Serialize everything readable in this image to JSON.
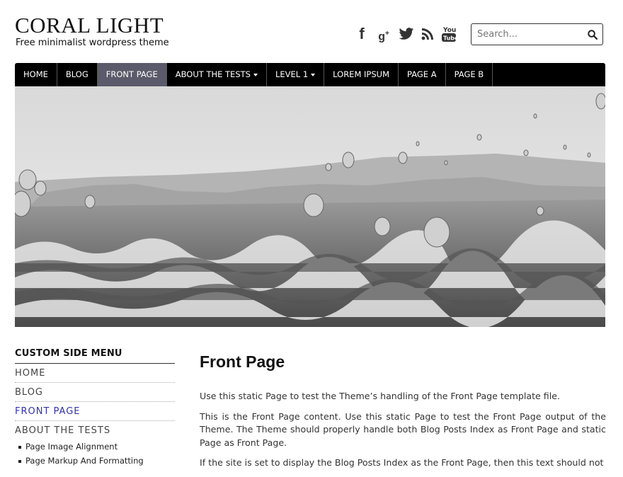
{
  "header": {
    "site_title": "CORAL LIGHT",
    "site_description": "Free minimalist wordpress theme",
    "social_icons": [
      "facebook-icon",
      "google-plus-icon",
      "twitter-icon",
      "rss-icon",
      "youtube-icon"
    ],
    "search_placeholder": "Search..."
  },
  "nav": {
    "items": [
      {
        "label": "HOME"
      },
      {
        "label": "BLOG"
      },
      {
        "label": "FRONT PAGE",
        "active": true
      },
      {
        "label": "ABOUT THE TESTS",
        "dropdown": true
      },
      {
        "label": "LEVEL 1",
        "dropdown": true
      },
      {
        "label": "LOREM IPSUM"
      },
      {
        "label": "PAGE A"
      },
      {
        "label": "PAGE B"
      }
    ]
  },
  "sidebar": {
    "title": "CUSTOM SIDE MENU",
    "items": [
      "HOME",
      "BLOG",
      "FRONT PAGE",
      "ABOUT THE TESTS"
    ],
    "sub_items": [
      "Page Image Alignment",
      "Page Markup And Formatting"
    ]
  },
  "content": {
    "title": "Front Page",
    "paragraphs": [
      "Use this static Page to test the Theme’s handling of the Front Page template file.",
      "This is the Front Page content. Use this static Page to test the Front Page output of the Theme. The Theme should properly handle both Blog Posts Index as Front Page and static Page as Front Page.",
      "If the site is set to display the Blog Posts Index as the Front Page, then this text should not"
    ]
  },
  "colors": {
    "nav_background": "#000000",
    "nav_active": "#5a5a6a",
    "sidebar_current": "#3333aa"
  }
}
